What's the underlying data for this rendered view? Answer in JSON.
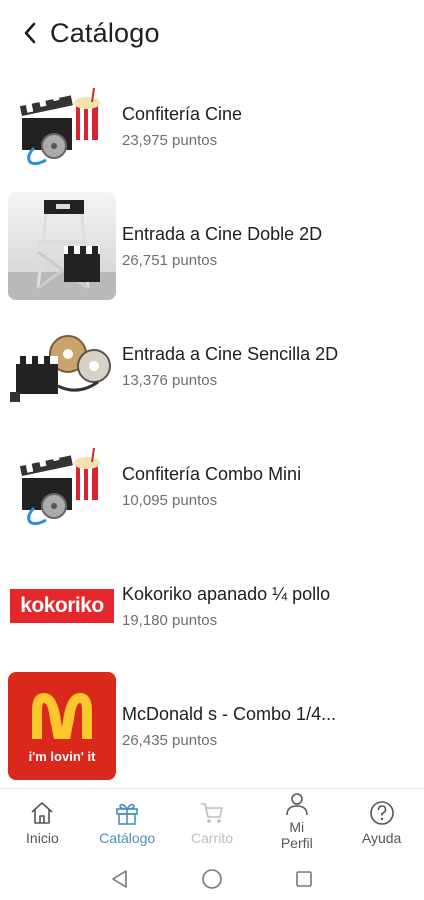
{
  "header": {
    "title": "Catálogo",
    "back_icon": "chevron-left-icon"
  },
  "items": [
    {
      "name": "Confitería Cine",
      "points": "23,975 puntos",
      "image": "cinema-clapper-popcorn"
    },
    {
      "name": "Entrada a Cine Doble 2D",
      "points": "26,751 puntos",
      "image": "director-chair-clapper"
    },
    {
      "name": "Entrada a Cine Sencilla 2D",
      "points": "13,376 puntos",
      "image": "film-reels-clapper"
    },
    {
      "name": "Confitería Combo Mini",
      "points": "10,095 puntos",
      "image": "cinema-clapper-popcorn"
    },
    {
      "name": "Kokoriko apanado ¼ pollo",
      "points": "19,180 puntos",
      "image": "kokoriko-logo",
      "logo_text": "kokoriko"
    },
    {
      "name": "McDonald s - Combo 1/4...",
      "points": "26,435 puntos",
      "image": "mcdonalds-logo",
      "logo_text": "i'm lovin' it"
    }
  ],
  "nav": {
    "inicio": "Inicio",
    "catalogo": "Catálogo",
    "carrito": "Carrito",
    "perfil_line1": "Mi",
    "perfil_line2": "Perfil",
    "ayuda": "Ayuda"
  },
  "colors": {
    "active": "#4a90b8",
    "disabled": "#bdbdbd",
    "kokoriko_red": "#e5262b",
    "mcd_red": "#da291c",
    "mcd_yellow": "#ffc72c"
  }
}
